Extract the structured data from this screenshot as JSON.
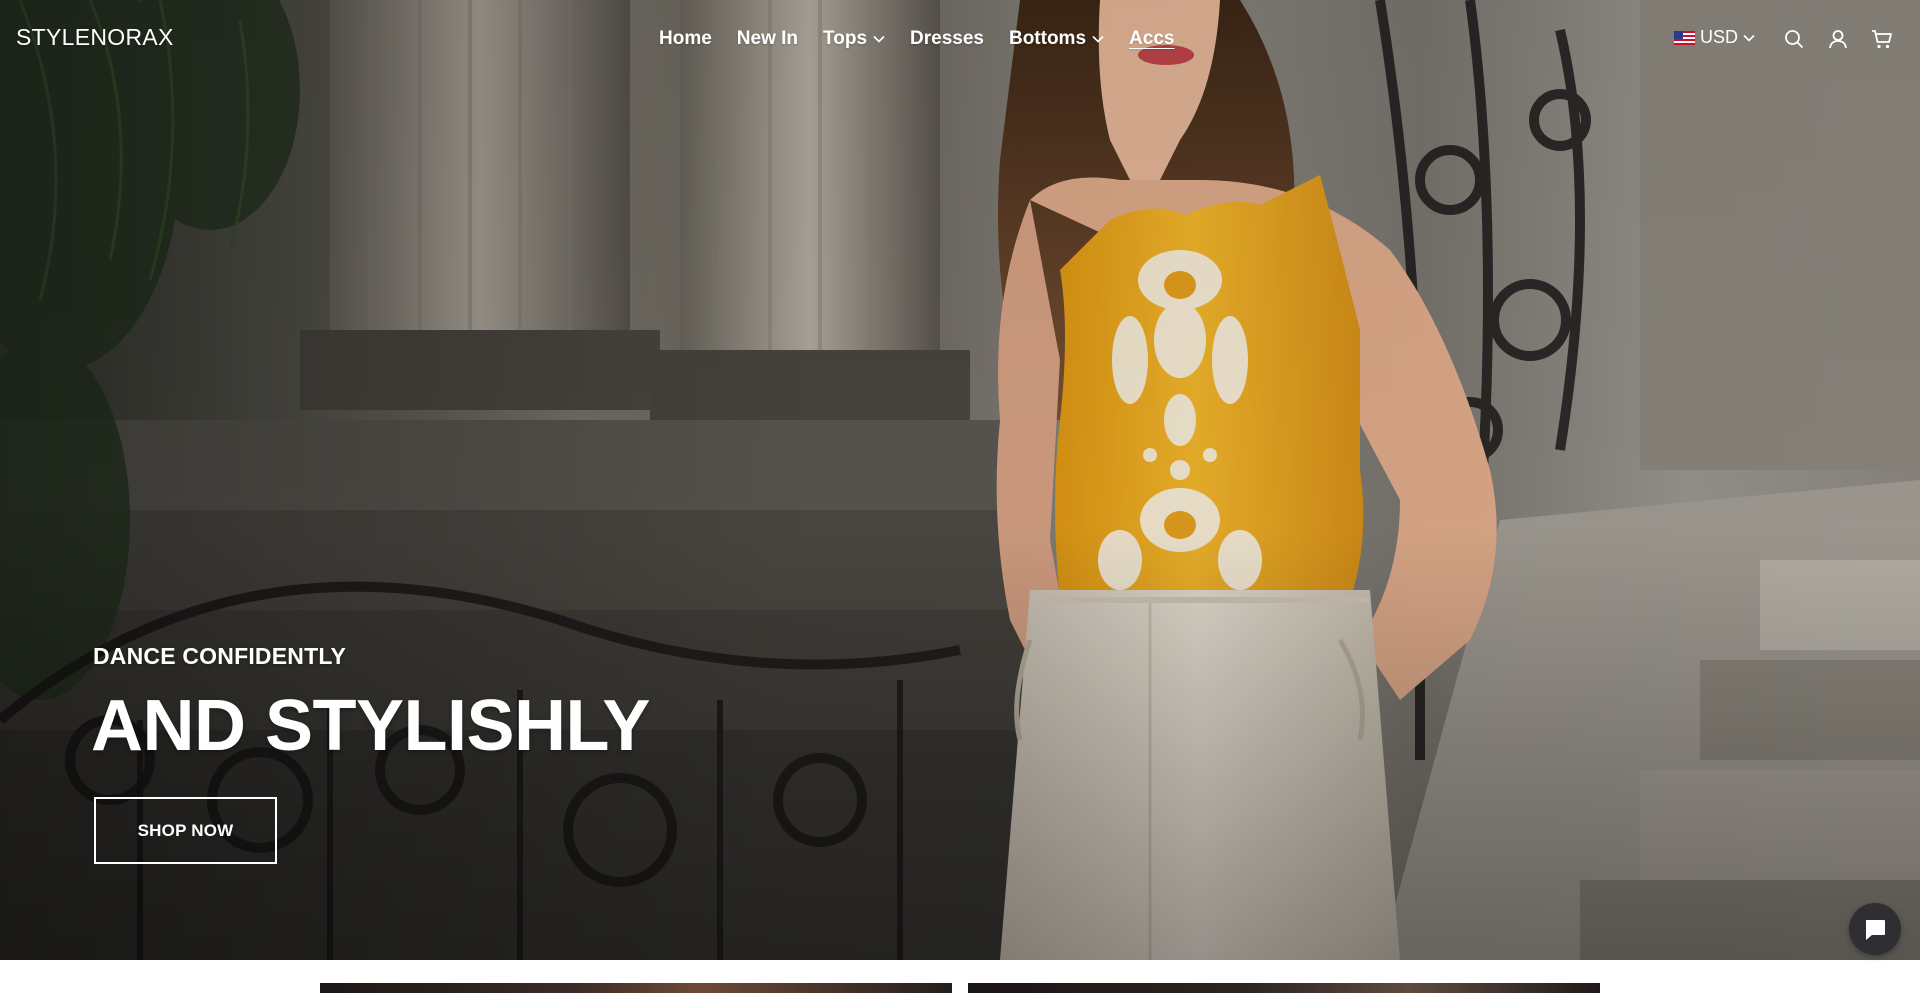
{
  "brand": {
    "name": "STYLENORAX"
  },
  "nav": {
    "items": [
      {
        "label": "Home",
        "has_dropdown": false
      },
      {
        "label": "New In",
        "has_dropdown": false
      },
      {
        "label": "Tops",
        "has_dropdown": true
      },
      {
        "label": "Dresses",
        "has_dropdown": false
      },
      {
        "label": "Bottoms",
        "has_dropdown": true
      },
      {
        "label": "Accs",
        "has_dropdown": false,
        "active": true
      }
    ]
  },
  "header": {
    "currency": {
      "label": "USD",
      "flag": "us-flag-icon"
    },
    "icons": [
      "search-icon",
      "account-icon",
      "cart-icon"
    ]
  },
  "hero": {
    "subtitle": "DANCE CONFIDENTLY",
    "title": "AND STYLISHLY",
    "cta_label": "SHOP NOW",
    "image": "woman-in-yellow-embroidered-top"
  },
  "chat": {
    "icon": "chat-bubble-icon"
  },
  "colors": {
    "header_text": "#ffffff",
    "top_yellow": "#f0b126",
    "pants_cream": "#e6ddd0",
    "chat_bg": "#2f2f33"
  }
}
